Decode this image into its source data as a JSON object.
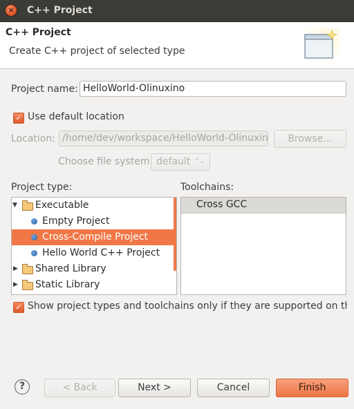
{
  "window": {
    "title": "C++ Project",
    "close_glyph": "×"
  },
  "header": {
    "title": "C++ Project",
    "description": "Create C++ project of selected type",
    "icon": "wizard-banner-icon"
  },
  "form": {
    "project_name_label": "Project name:",
    "project_name_value": "HelloWorld-Olinuxino",
    "use_default_location_label": "Use default location",
    "use_default_location_checked": true,
    "location_label": "Location:",
    "location_value": "/home/dev/workspace/HelloWorld-Olinuxino",
    "browse_label": "Browse...",
    "file_system_label": "Choose file system:",
    "file_system_value": "default",
    "file_system_glyph": "⌃⌄"
  },
  "project_type": {
    "label": "Project type:",
    "items": [
      {
        "label": "Executable",
        "kind": "folder",
        "expanded": true
      },
      {
        "label": "Empty Project",
        "kind": "leaf"
      },
      {
        "label": "Cross-Compile Project",
        "kind": "leaf",
        "selected": true
      },
      {
        "label": "Hello World C++ Project",
        "kind": "leaf"
      },
      {
        "label": "Shared Library",
        "kind": "folder",
        "expanded": false
      },
      {
        "label": "Static Library",
        "kind": "folder",
        "expanded": false
      }
    ]
  },
  "toolchains": {
    "label": "Toolchains:",
    "items": [
      {
        "label": "Cross GCC",
        "selected": true
      }
    ]
  },
  "filter_checkbox": {
    "label": "Show project types and toolchains only if they are supported on the p",
    "checked": true
  },
  "buttons": {
    "help": "?",
    "back": "< Back",
    "next": "Next >",
    "cancel": "Cancel",
    "finish": "Finish"
  },
  "colors": {
    "accent": "#f07746",
    "titlebar": "#3b3b37",
    "dialog_bg": "#f2f1f0"
  }
}
